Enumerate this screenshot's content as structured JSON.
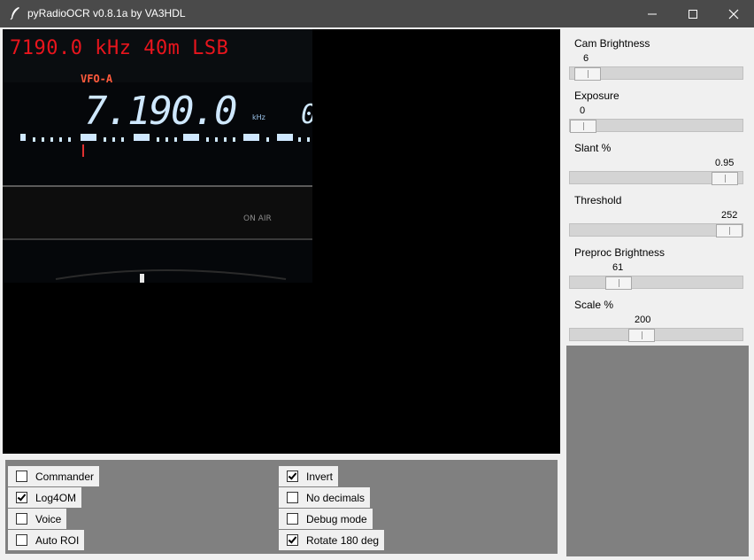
{
  "window": {
    "title": "pyRadioOCR v0.8.1a by VA3HDL",
    "minimize_icon": "minimize-icon",
    "maximize_icon": "maximize-icon",
    "close_icon": "close-icon"
  },
  "video": {
    "ocr_overlay": "7190.0 kHz 40m LSB",
    "display_labels": {
      "vfo": "VFO-A",
      "frequency": "7.190.0",
      "unit": "kHz",
      "on_air": "ON AIR"
    }
  },
  "options": {
    "left": [
      {
        "label": "Commander",
        "checked": false
      },
      {
        "label": "Log4OM",
        "checked": true
      },
      {
        "label": "Voice",
        "checked": false
      },
      {
        "label": "Auto ROI",
        "checked": false
      }
    ],
    "right": [
      {
        "label": "Invert",
        "checked": true
      },
      {
        "label": "No decimals",
        "checked": false
      },
      {
        "label": "Debug mode",
        "checked": false
      },
      {
        "label": "Rotate 180 deg",
        "checked": true
      }
    ]
  },
  "sliders": [
    {
      "label": "Cam Brightness",
      "value": "6",
      "position": 0.03
    },
    {
      "label": "Exposure",
      "value": "0",
      "position": 0.0
    },
    {
      "label": "Slant %",
      "value": "0.95",
      "position": 0.95
    },
    {
      "label": "Threshold",
      "value": "252",
      "position": 0.99
    },
    {
      "label": "Preproc Brightness",
      "value": "61",
      "position": 0.24
    },
    {
      "label": "Scale %",
      "value": "200",
      "position": 0.4
    }
  ],
  "colors": {
    "titlebar": "#4a4a4a",
    "ocr_text": "#e8151d",
    "panel": "#808080",
    "display_glow": "#cfe8ff"
  }
}
